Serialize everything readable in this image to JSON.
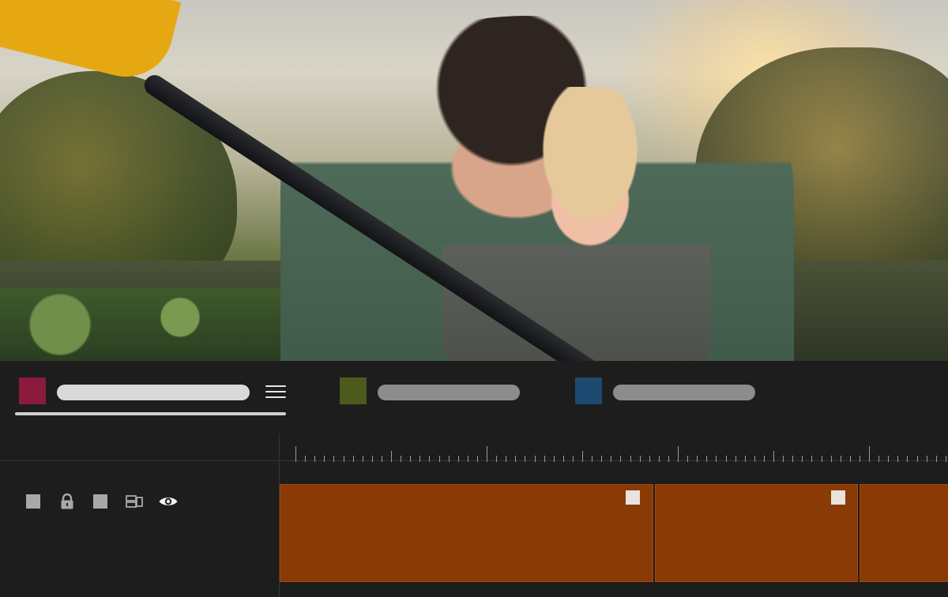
{
  "colors": {
    "panel_bg": "#1d1d1d",
    "tab1_swatch": "#8a1b3c",
    "tab2_swatch": "#4c5a1c",
    "tab3_swatch": "#1c4a70",
    "clip": "#8a3a04",
    "clip_marker": "#e9e3dc"
  },
  "preview": {
    "image": "photo-mother-and-child-kayaking"
  },
  "tabs": [
    {
      "label": "",
      "active": true,
      "swatch_color": "#8a1b3c",
      "icon": "hamburger-menu-icon"
    },
    {
      "label": "",
      "active": false,
      "swatch_color": "#4c5a1c"
    },
    {
      "label": "",
      "active": false,
      "swatch_color": "#1c4a70"
    }
  ],
  "track_controls": [
    {
      "icon": "square-icon"
    },
    {
      "icon": "lock-icon"
    },
    {
      "icon": "square-icon"
    },
    {
      "icon": "label-tag-icon"
    },
    {
      "icon": "eye-icon"
    }
  ],
  "clips": [
    {
      "marker": true
    },
    {
      "marker": true
    },
    {
      "marker": false
    }
  ]
}
